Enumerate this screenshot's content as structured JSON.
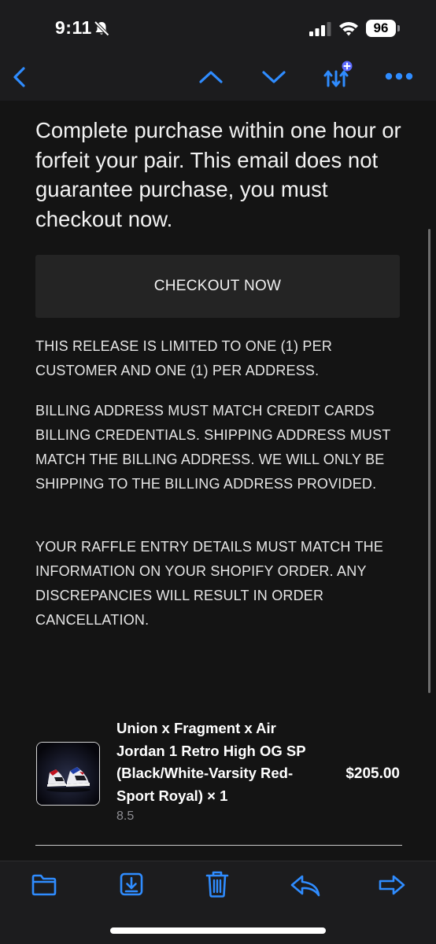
{
  "status_bar": {
    "time": "9:11",
    "battery": "96"
  },
  "nav": {
    "icons": [
      "back-chevron-icon",
      "previous-message-icon",
      "next-message-icon",
      "smart-sort-icon",
      "more-icon"
    ]
  },
  "email": {
    "headline": "Complete purchase within one hour or forfeit your pair. This email does not guarantee purchase, you must checkout now.",
    "checkout_label": "CHECKOUT NOW",
    "notices": [
      "THIS RELEASE IS LIMITED TO ONE (1) PER CUSTOMER AND ONE (1) PER ADDRESS.",
      "BILLING ADDRESS MUST MATCH CREDIT CARDS BILLING CREDENTIALS. SHIPPING ADDRESS MUST MATCH THE BILLING ADDRESS. WE WILL ONLY BE SHIPPING TO THE BILLING ADDRESS PROVIDED.",
      "YOUR RAFFLE ENTRY DETAILS MUST MATCH THE INFORMATION ON YOUR SHOPIFY ORDER. ANY DISCREPANCIES WILL RESULT IN ORDER CANCELLATION."
    ],
    "product": {
      "name": "Union x Fragment x Air Jordan 1 Retro High OG SP (Black/White-Varsity Red-Sport Royal) × 1",
      "variant": "8.5",
      "price": "$205.00"
    }
  },
  "toolbar": {
    "icons": [
      "folder-icon",
      "archive-icon",
      "trash-icon",
      "reply-icon",
      "forward-icon"
    ]
  },
  "colors": {
    "accent": "#2f8cff",
    "background": "#141414",
    "chrome": "#1c1c1e",
    "button": "#242424"
  }
}
